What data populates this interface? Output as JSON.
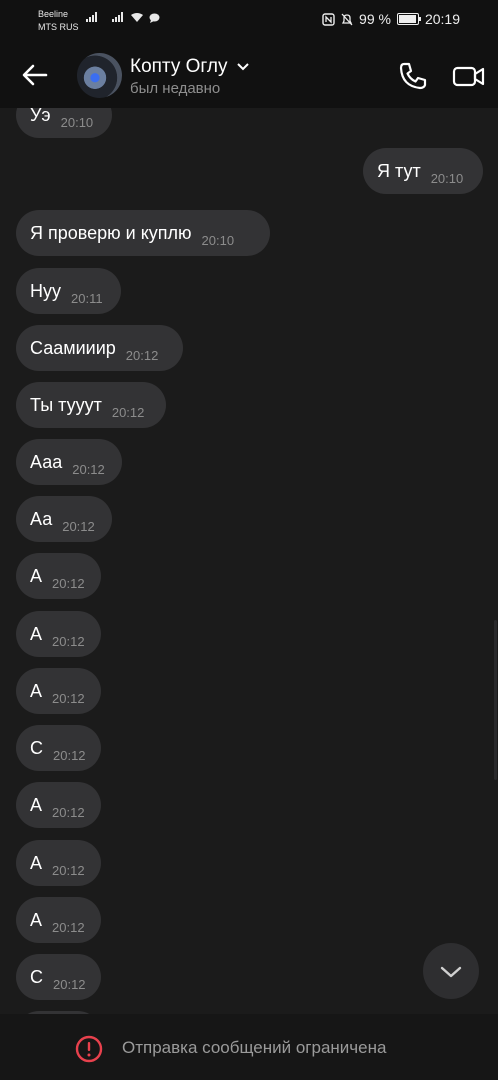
{
  "status_bar": {
    "carrier_1": "Beeline",
    "carrier_2": "MTS RUS",
    "battery": "99 %",
    "time": "20:19"
  },
  "header": {
    "contact_name": "Копту Оглу",
    "status": "был недавно"
  },
  "messages": [
    {
      "text": "Уэ",
      "time": "20:10",
      "side": "in"
    },
    {
      "text": "Я тут",
      "time": "20:10",
      "side": "out"
    },
    {
      "text": "Я проверю и куплю",
      "time": "20:10",
      "side": "in"
    },
    {
      "text": "Нуу",
      "time": "20:11",
      "side": "in"
    },
    {
      "text": "Саамииир",
      "time": "20:12",
      "side": "in"
    },
    {
      "text": "Ты тууут",
      "time": "20:12",
      "side": "in"
    },
    {
      "text": "Ааа",
      "time": "20:12",
      "side": "in"
    },
    {
      "text": "Аа",
      "time": "20:12",
      "side": "in"
    },
    {
      "text": "А",
      "time": "20:12",
      "side": "in"
    },
    {
      "text": "А",
      "time": "20:12",
      "side": "in"
    },
    {
      "text": "А",
      "time": "20:12",
      "side": "in"
    },
    {
      "text": "С",
      "time": "20:12",
      "side": "in"
    },
    {
      "text": "А",
      "time": "20:12",
      "side": "in"
    },
    {
      "text": "А",
      "time": "20:12",
      "side": "in"
    },
    {
      "text": "А",
      "time": "20:12",
      "side": "in"
    },
    {
      "text": "С",
      "time": "20:12",
      "side": "in"
    }
  ],
  "footer": {
    "restriction_text": "Отправка сообщений ограничена"
  },
  "colors": {
    "background": "#1b1b1b",
    "bubble": "#333335",
    "warning": "#e8414d"
  }
}
